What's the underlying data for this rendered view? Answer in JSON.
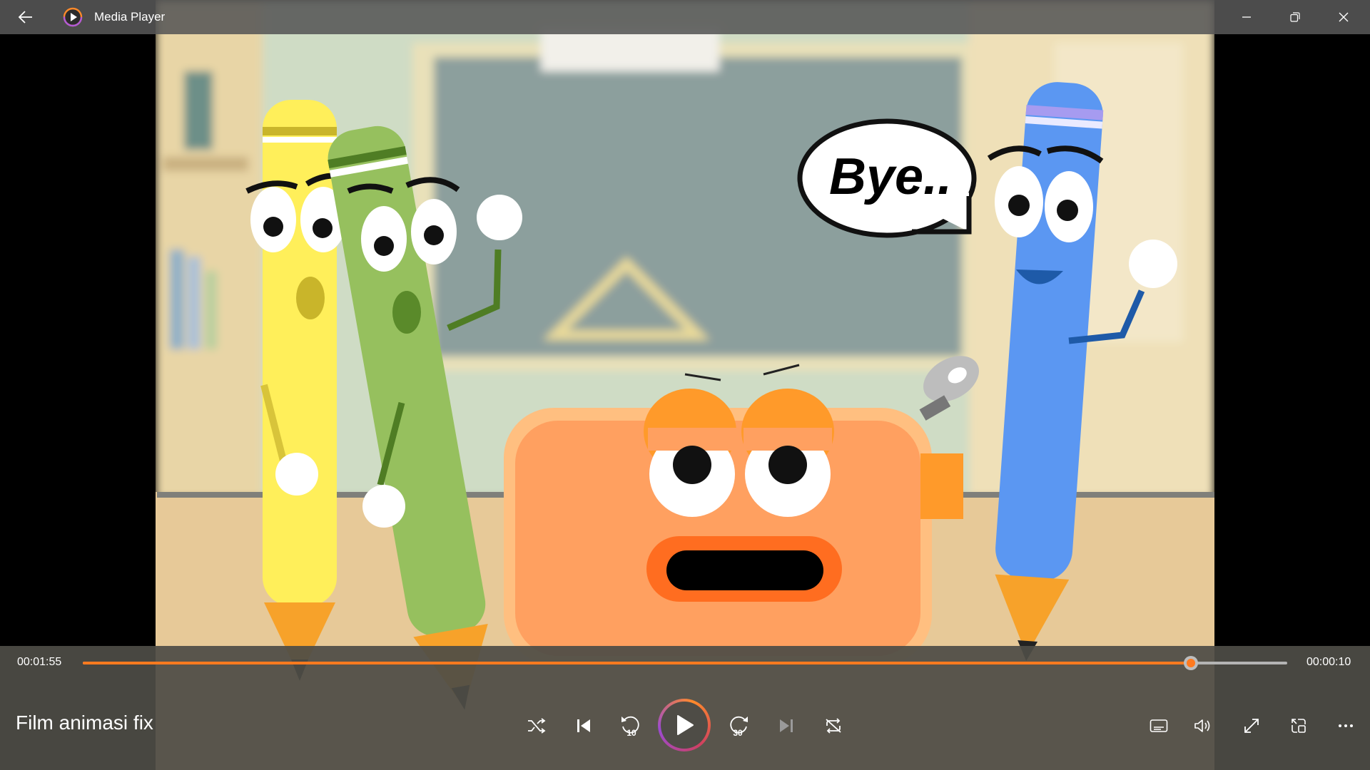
{
  "window": {
    "app_title": "Media Player",
    "icons": {
      "back": "back-arrow-icon",
      "app": "media-player-logo-icon",
      "minimize": "minimize-icon",
      "maximize": "restore-icon",
      "close": "close-icon"
    }
  },
  "video": {
    "speech_bubble_text": "Bye.."
  },
  "playback": {
    "elapsed": "00:01:55",
    "remaining": "00:00:10",
    "progress": 0.92,
    "state": "paused"
  },
  "media": {
    "title": "Film animasi fix"
  },
  "controls": {
    "center": [
      "shuffle-icon",
      "previous-icon",
      "skip-back-10-icon",
      "play-icon",
      "skip-forward-30-icon",
      "next-icon",
      "repeat-icon"
    ],
    "skip_back_label": "10",
    "skip_forward_label": "30",
    "right": [
      "captions-icon",
      "volume-icon",
      "fullscreen-icon",
      "mini-player-icon",
      "more-icon"
    ]
  },
  "colors": {
    "accent": "#ff7a1f",
    "titlebar": "#565656",
    "control_bar": "#4e4c46"
  }
}
